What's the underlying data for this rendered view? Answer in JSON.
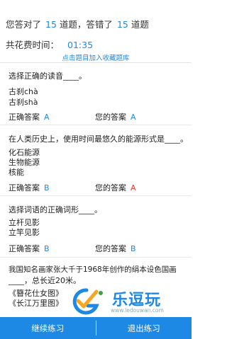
{
  "summary": {
    "p1": "您答对了",
    "correct": "15",
    "p2": "道题，答错了",
    "wrong": "15",
    "p3": "道题"
  },
  "timer": {
    "label": "共花费时间：",
    "value": "01:35"
  },
  "favorite_link": "点击题目加入收藏题库",
  "answer_label": "正确答案",
  "your_label": "您的答案",
  "questions": [
    {
      "title": "选择正确的读音____。",
      "options": [
        "古刹chà",
        "古刹shà"
      ],
      "correct": "A",
      "yours": "A",
      "yours_color": "#1e88e5"
    },
    {
      "title": "在人类历史上，使用时间最悠久的能源形式是____。",
      "options": [
        "化石能源",
        "生物能源",
        "核能"
      ],
      "correct": "B",
      "yours": "A",
      "yours_color": "#e53935"
    },
    {
      "title": "选择词语的正确词形____。",
      "options": [
        "立杆见影",
        "立竿见影"
      ],
      "correct": "B",
      "yours": "B",
      "yours_color": "#1e88e5"
    },
    {
      "title_line1": "我国知名画家张大千于1968年创作的绢本设色国画",
      "title_line2": "____，总长近20米。",
      "options": [
        "《簪花仕女图》",
        "《长江万里图》"
      ]
    }
  ],
  "watermark": {
    "brand": "乐逗玩",
    "url": "www.ledouwan.com"
  },
  "buttons": {
    "continue": "继续练习",
    "exit": "退出练习"
  },
  "colors": {
    "accent": "#1e88e5",
    "wrong": "#e53935"
  }
}
